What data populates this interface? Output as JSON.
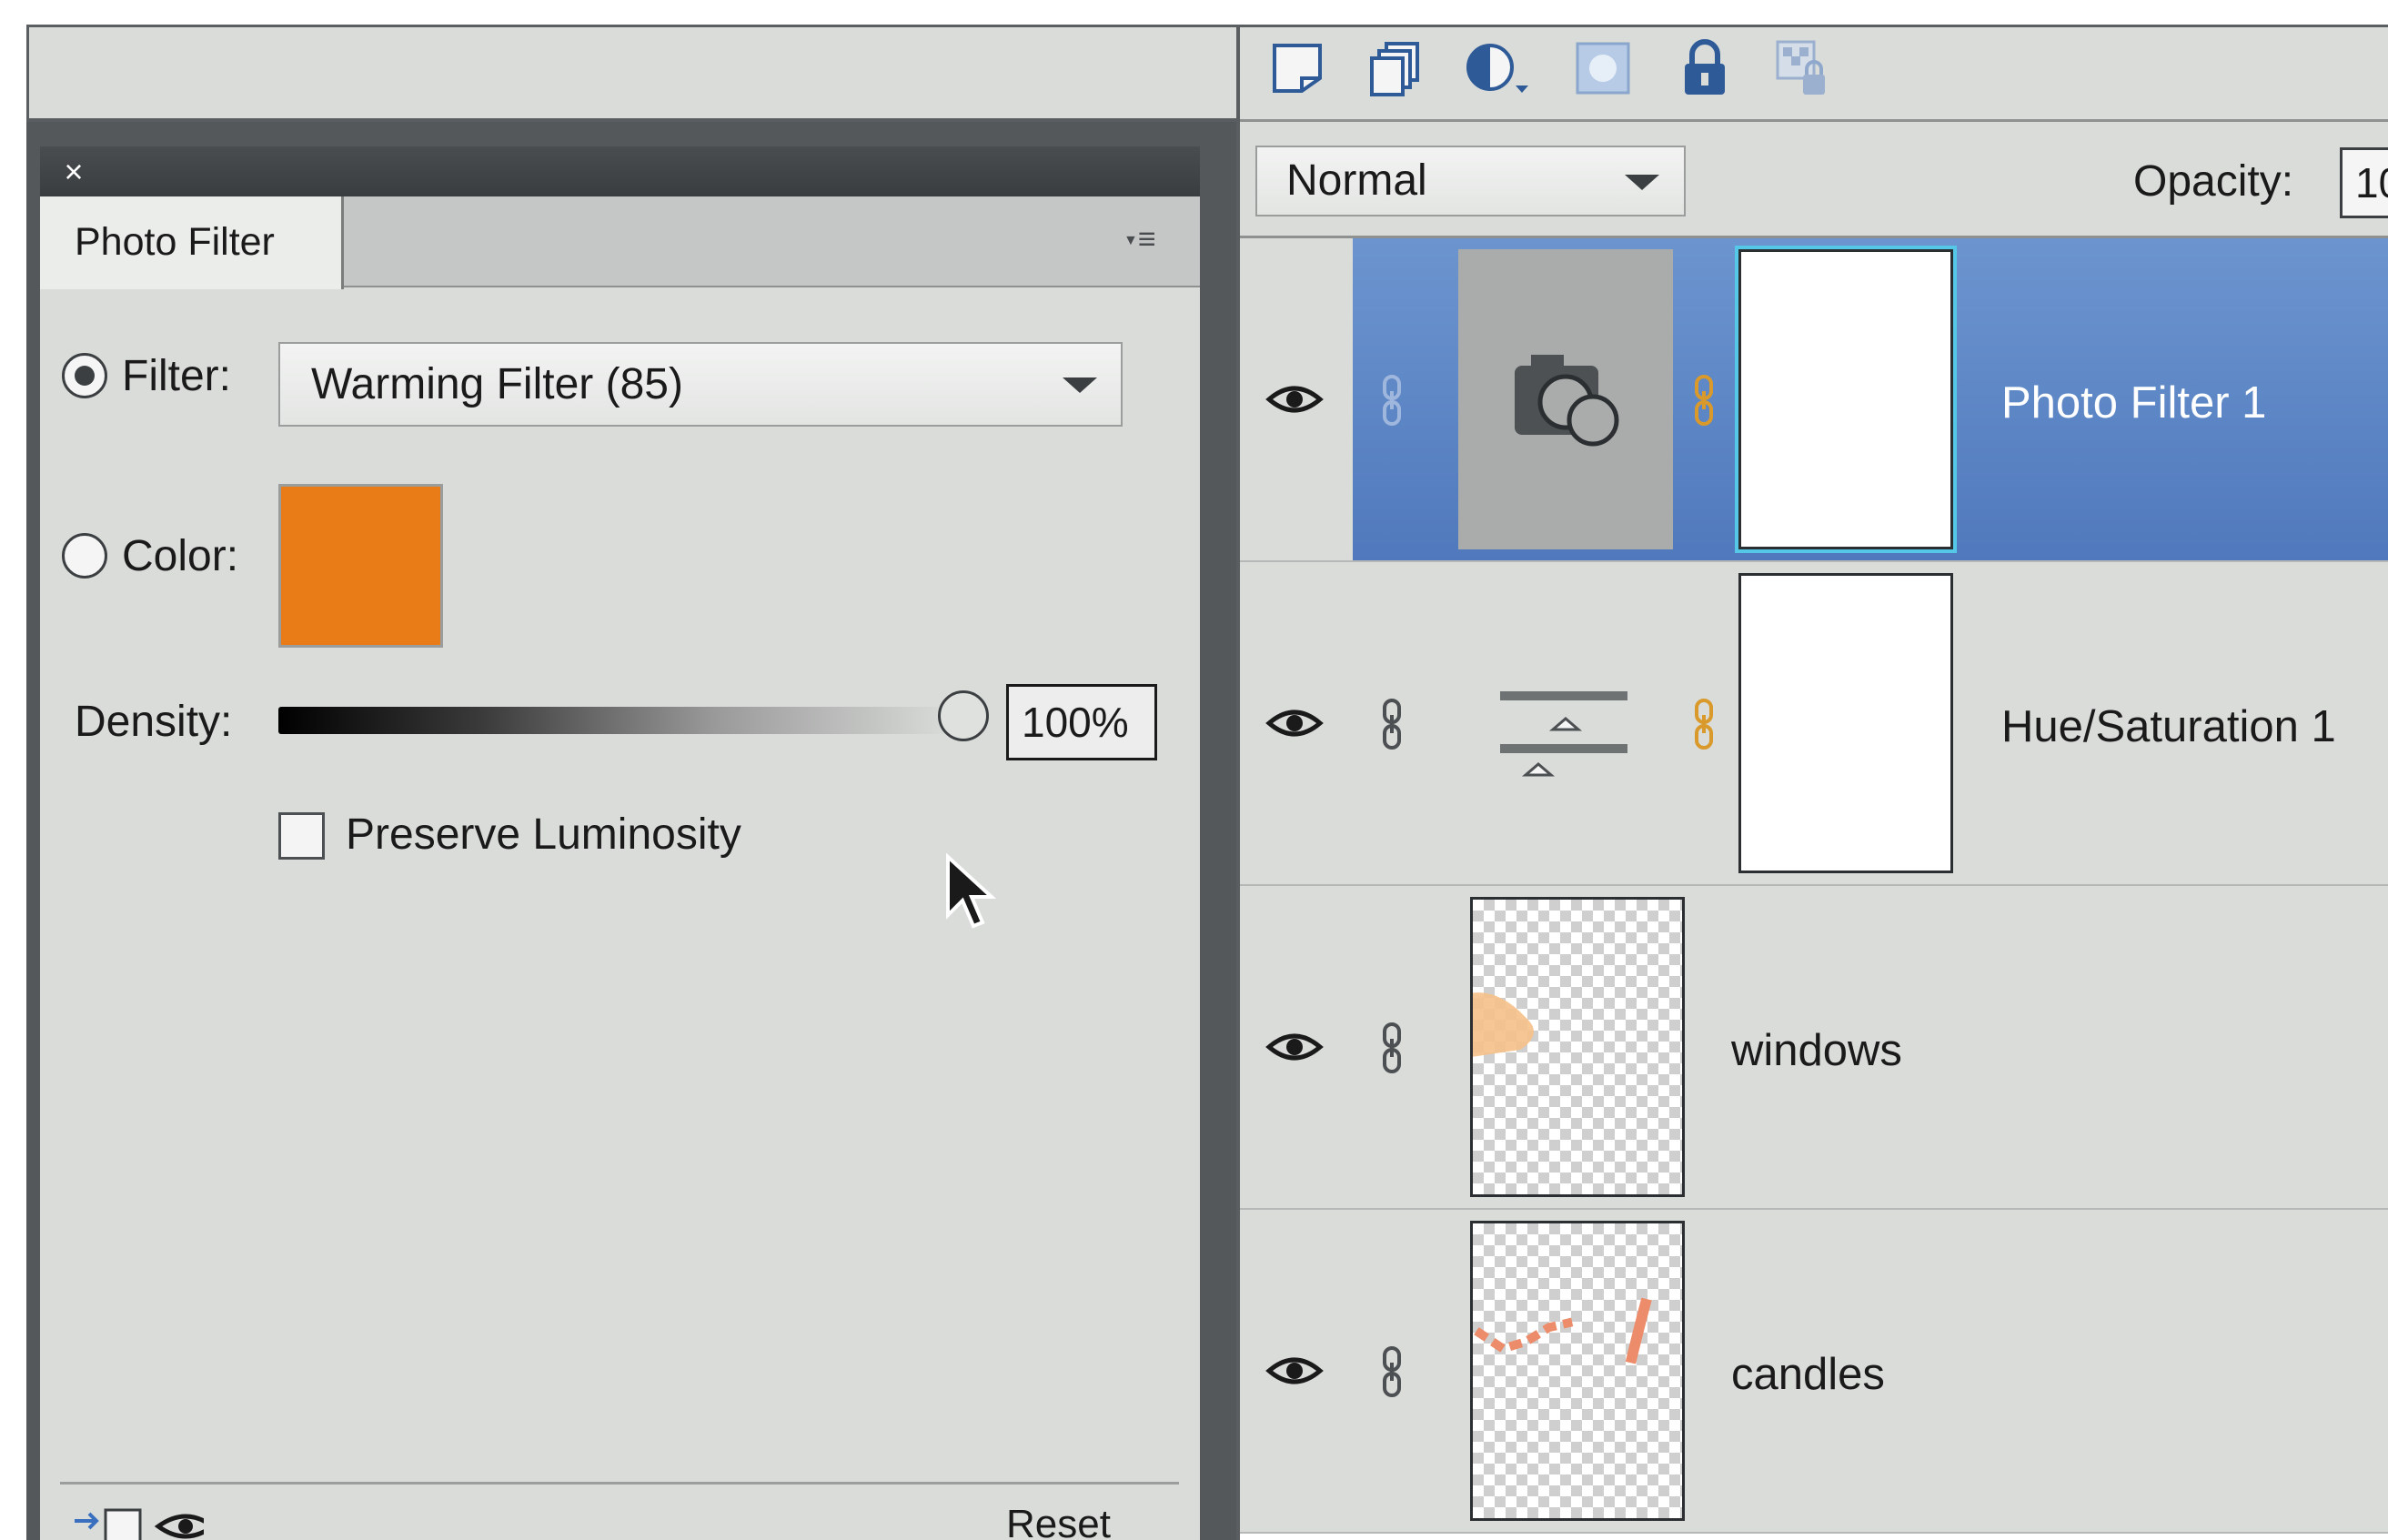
{
  "photo_filter_panel": {
    "close_label": "×",
    "tab_label": "Photo Filter",
    "menu_icon": "panel-menu-icon",
    "filter": {
      "label": "Filter:",
      "selected": true,
      "value": "Warming Filter (85)"
    },
    "color": {
      "label": "Color:",
      "selected": false,
      "swatch_hex": "#e97c16"
    },
    "density": {
      "label": "Density:",
      "value": "100%",
      "level": 1.0
    },
    "preserve_luminosity": {
      "label": "Preserve Luminosity",
      "checked": false
    },
    "footer": {
      "reset_label": "Reset",
      "icons": [
        "clip-to-layer-icon",
        "visibility-eye-icon"
      ]
    }
  },
  "layers_panel": {
    "toolbar_icons": [
      "new-layer-icon",
      "duplicate-layer-icon",
      "adjustment-layer-icon",
      "add-mask-icon",
      "lock-all-icon",
      "lock-transparency-icon"
    ],
    "blend_mode": "Normal",
    "opacity_label": "Opacity:",
    "opacity_value": "10",
    "layers": [
      {
        "name": "Photo Filter 1",
        "type": "adjustment",
        "selected": true
      },
      {
        "name": "Hue/Saturation 1",
        "type": "adjustment",
        "selected": false
      },
      {
        "name": "windows",
        "type": "pixel",
        "selected": false
      },
      {
        "name": "candles",
        "type": "pixel",
        "selected": false
      }
    ],
    "colors": {
      "selection": "#5a85c6",
      "mask_highlight": "#55c8e8",
      "link_active": "#d99a2b"
    }
  }
}
